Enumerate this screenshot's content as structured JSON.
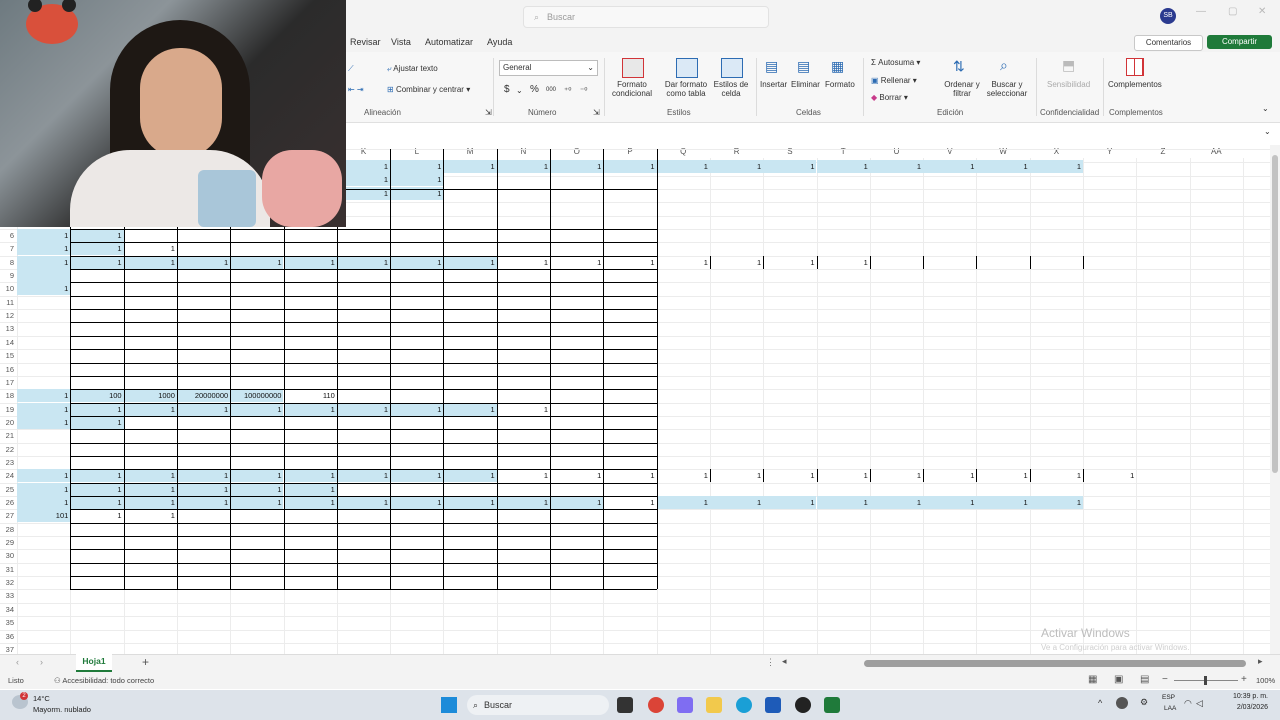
{
  "titlebar": {
    "search_placeholder": "Buscar",
    "avatar_initials": "SB"
  },
  "menu": [
    "Revisar",
    "Vista",
    "Automatizar",
    "Ayuda"
  ],
  "actions": {
    "comments": "Comentarios",
    "share": "Compartir"
  },
  "ribbon": {
    "alignment": {
      "wrap_text": "Ajustar texto",
      "merge_center": "Combinar y centrar",
      "group_label": "Alineación"
    },
    "number": {
      "format_value": "General",
      "currency": "$",
      "percent": "%",
      "thousands": "000",
      "group_label": "Número"
    },
    "styles": {
      "conditional": "Formato condicional",
      "as_table": "Dar formato como tabla",
      "cell_styles": "Estilos de celda",
      "group_label": "Estilos"
    },
    "cells": {
      "insert": "Insertar",
      "delete": "Eliminar",
      "format": "Formato",
      "group_label": "Celdas"
    },
    "editing": {
      "autosum": "Autosuma",
      "fill": "Rellenar",
      "clear": "Borrar",
      "sort_filter": "Ordenar y filtrar",
      "find_select": "Buscar y seleccionar",
      "group_label": "Edición"
    },
    "sensitivity": {
      "label": "Sensibilidad",
      "group_label": "Confidencialidad"
    },
    "addins": {
      "label": "Complementos",
      "group_label": "Complementos"
    }
  },
  "grid": {
    "columns": [
      "K",
      "L",
      "M",
      "N",
      "O",
      "P",
      "Q",
      "R",
      "S",
      "T",
      "U",
      "V",
      "W",
      "X",
      "Y",
      "Z",
      "AA"
    ],
    "rows": [
      "6",
      "7",
      "8",
      "9",
      "10",
      "11",
      "12",
      "13",
      "14",
      "15",
      "16",
      "17",
      "18",
      "19",
      "20",
      "21",
      "22",
      "23",
      "24",
      "25",
      "26",
      "27",
      "28",
      "29",
      "30",
      "31",
      "32",
      "33",
      "34",
      "35",
      "36",
      "37"
    ],
    "cells": [
      {
        "r": 0,
        "c": 0,
        "v": "1",
        "h": true
      },
      {
        "r": 0,
        "c": 1,
        "v": "1",
        "h": true
      },
      {
        "r": 1,
        "c": 0,
        "v": "1",
        "h": true
      },
      {
        "r": 1,
        "c": 1,
        "v": "1",
        "h": true
      },
      {
        "r": 1,
        "c": 2,
        "v": "1",
        "h": false
      },
      {
        "r": 2,
        "c": 0,
        "v": "1",
        "h": true
      },
      {
        "r": 2,
        "c": 1,
        "v": "1",
        "h": true
      },
      {
        "r": 2,
        "c": 2,
        "v": "1",
        "h": true
      },
      {
        "r": 2,
        "c": 3,
        "v": "1",
        "h": true
      },
      {
        "r": 2,
        "c": 4,
        "v": "1",
        "h": true
      },
      {
        "r": 2,
        "c": 5,
        "v": "1",
        "h": true
      },
      {
        "r": 2,
        "c": 6,
        "v": "1",
        "h": true
      },
      {
        "r": 2,
        "c": 7,
        "v": "1",
        "h": true
      },
      {
        "r": 2,
        "c": 8,
        "v": "1",
        "h": true
      },
      {
        "r": 2,
        "c": 9,
        "v": "1",
        "h": false
      },
      {
        "r": 2,
        "c": 10,
        "v": "1",
        "h": false
      },
      {
        "r": 2,
        "c": 11,
        "v": "1",
        "h": false
      },
      {
        "r": 2,
        "c": 12,
        "v": "1",
        "h": false
      },
      {
        "r": 2,
        "c": 13,
        "v": "1",
        "h": false
      },
      {
        "r": 2,
        "c": 14,
        "v": "1",
        "h": false
      },
      {
        "r": 2,
        "c": 15,
        "v": "1",
        "h": false
      },
      {
        "r": 3,
        "c": 0,
        "v": "",
        "h": true
      },
      {
        "r": 4,
        "c": 0,
        "v": "1",
        "h": true
      },
      {
        "r": 12,
        "c": 0,
        "v": "1",
        "h": true
      },
      {
        "r": 12,
        "c": 1,
        "v": "100",
        "h": true
      },
      {
        "r": 12,
        "c": 2,
        "v": "1000",
        "h": true
      },
      {
        "r": 12,
        "c": 3,
        "v": "20000000",
        "h": true
      },
      {
        "r": 12,
        "c": 4,
        "v": "100000000",
        "h": true
      },
      {
        "r": 12,
        "c": 5,
        "v": "110",
        "h": false
      },
      {
        "r": 13,
        "c": 0,
        "v": "1",
        "h": true
      },
      {
        "r": 13,
        "c": 1,
        "v": "1",
        "h": true
      },
      {
        "r": 13,
        "c": 2,
        "v": "1",
        "h": true
      },
      {
        "r": 13,
        "c": 3,
        "v": "1",
        "h": true
      },
      {
        "r": 13,
        "c": 4,
        "v": "1",
        "h": true
      },
      {
        "r": 13,
        "c": 5,
        "v": "1",
        "h": true
      },
      {
        "r": 13,
        "c": 6,
        "v": "1",
        "h": true
      },
      {
        "r": 13,
        "c": 7,
        "v": "1",
        "h": true
      },
      {
        "r": 13,
        "c": 8,
        "v": "1",
        "h": true
      },
      {
        "r": 13,
        "c": 9,
        "v": "1",
        "h": false
      },
      {
        "r": 14,
        "c": 0,
        "v": "1",
        "h": true
      },
      {
        "r": 14,
        "c": 1,
        "v": "1",
        "h": true
      },
      {
        "r": 18,
        "c": 0,
        "v": "1",
        "h": true
      },
      {
        "r": 18,
        "c": 1,
        "v": "1",
        "h": true
      },
      {
        "r": 18,
        "c": 2,
        "v": "1",
        "h": true
      },
      {
        "r": 18,
        "c": 3,
        "v": "1",
        "h": true
      },
      {
        "r": 18,
        "c": 4,
        "v": "1",
        "h": true
      },
      {
        "r": 18,
        "c": 5,
        "v": "1",
        "h": true
      },
      {
        "r": 18,
        "c": 6,
        "v": "1",
        "h": true
      },
      {
        "r": 18,
        "c": 7,
        "v": "1",
        "h": true
      },
      {
        "r": 18,
        "c": 8,
        "v": "1",
        "h": true
      },
      {
        "r": 18,
        "c": 9,
        "v": "1",
        "h": false
      },
      {
        "r": 18,
        "c": 10,
        "v": "1",
        "h": false
      },
      {
        "r": 18,
        "c": 11,
        "v": "1",
        "h": false
      },
      {
        "r": 18,
        "c": 12,
        "v": "1",
        "h": false
      },
      {
        "r": 18,
        "c": 13,
        "v": "1",
        "h": false
      },
      {
        "r": 18,
        "c": 14,
        "v": "1",
        "h": false
      },
      {
        "r": 18,
        "c": 15,
        "v": "1",
        "h": false
      },
      {
        "r": 18,
        "c": 16,
        "v": "1",
        "h": false
      },
      {
        "r": 18,
        "c": 17,
        "v": "1",
        "h": false
      },
      {
        "r": 18,
        "c": 18,
        "v": "1",
        "h": false
      },
      {
        "r": 18,
        "c": 19,
        "v": "1",
        "h": false
      },
      {
        "r": 18,
        "c": 20,
        "v": "1",
        "h": false
      },
      {
        "r": 19,
        "c": 0,
        "v": "1",
        "h": true
      },
      {
        "r": 19,
        "c": 1,
        "v": "1",
        "h": true
      },
      {
        "r": 19,
        "c": 2,
        "v": "1",
        "h": true
      },
      {
        "r": 19,
        "c": 3,
        "v": "1",
        "h": true
      },
      {
        "r": 19,
        "c": 4,
        "v": "1",
        "h": true
      },
      {
        "r": 19,
        "c": 5,
        "v": "1",
        "h": true
      },
      {
        "r": 20,
        "c": 0,
        "v": "1",
        "h": true
      },
      {
        "r": 20,
        "c": 1,
        "v": "1",
        "h": true
      },
      {
        "r": 20,
        "c": 2,
        "v": "1",
        "h": true
      },
      {
        "r": 20,
        "c": 3,
        "v": "1",
        "h": true
      },
      {
        "r": 20,
        "c": 4,
        "v": "1",
        "h": true
      },
      {
        "r": 20,
        "c": 5,
        "v": "1",
        "h": true
      },
      {
        "r": 20,
        "c": 6,
        "v": "1",
        "h": true
      },
      {
        "r": 20,
        "c": 7,
        "v": "1",
        "h": true
      },
      {
        "r": 20,
        "c": 8,
        "v": "1",
        "h": true
      },
      {
        "r": 20,
        "c": 9,
        "v": "1",
        "h": true
      },
      {
        "r": 20,
        "c": 10,
        "v": "1",
        "h": true
      },
      {
        "r": 20,
        "c": 11,
        "v": "1",
        "h": false
      },
      {
        "r": 20,
        "c": 12,
        "v": "1",
        "h": true
      },
      {
        "r": 20,
        "c": 13,
        "v": "1",
        "h": true
      },
      {
        "r": 20,
        "c": 14,
        "v": "1",
        "h": true
      },
      {
        "r": 20,
        "c": 15,
        "v": "1",
        "h": true
      },
      {
        "r": 20,
        "c": 16,
        "v": "1",
        "h": true
      },
      {
        "r": 20,
        "c": 17,
        "v": "1",
        "h": true
      },
      {
        "r": 20,
        "c": 18,
        "v": "1",
        "h": true
      },
      {
        "r": 20,
        "c": 19,
        "v": "1",
        "h": true
      },
      {
        "r": 21,
        "c": 0,
        "v": "101",
        "h": true
      },
      {
        "r": 21,
        "c": 1,
        "v": "1",
        "h": false
      },
      {
        "r": 21,
        "c": 2,
        "v": "1",
        "h": false
      }
    ],
    "top_cells": [
      {
        "r": 0,
        "c": 6,
        "v": "1",
        "h": true
      },
      {
        "r": 0,
        "c": 7,
        "v": "1",
        "h": true
      },
      {
        "r": 0,
        "c": 8,
        "v": "1",
        "h": true
      },
      {
        "r": 0,
        "c": 9,
        "v": "1",
        "h": true
      },
      {
        "r": 0,
        "c": 10,
        "v": "1",
        "h": true
      },
      {
        "r": 0,
        "c": 11,
        "v": "1",
        "h": true
      },
      {
        "r": 0,
        "c": 12,
        "v": "1",
        "h": true
      },
      {
        "r": 0,
        "c": 13,
        "v": "1",
        "h": true
      },
      {
        "r": 0,
        "c": 14,
        "v": "1",
        "h": true
      },
      {
        "r": 0,
        "c": 15,
        "v": "1",
        "h": true
      },
      {
        "r": 0,
        "c": 16,
        "v": "1",
        "h": true
      },
      {
        "r": 0,
        "c": 17,
        "v": "1",
        "h": true
      },
      {
        "r": 0,
        "c": 18,
        "v": "1",
        "h": true
      },
      {
        "r": 0,
        "c": 19,
        "v": "1",
        "h": true
      },
      {
        "r": 1,
        "c": 6,
        "v": "1",
        "h": true
      },
      {
        "r": 1,
        "c": 7,
        "v": "1",
        "h": true
      },
      {
        "r": 2,
        "c": 6,
        "v": "1",
        "h": true
      },
      {
        "r": 2,
        "c": 7,
        "v": "1",
        "h": true
      }
    ]
  },
  "sheet": {
    "tab": "Hoja1"
  },
  "status": {
    "ready": "Listo",
    "accessibility": "Accesibilidad: todo correcto",
    "zoom": "100%"
  },
  "watermark": {
    "title": "Activar Windows",
    "subtitle": "Ve a Configuración para activar Windows."
  },
  "taskbar": {
    "weather_temp": "14°C",
    "weather_desc": "Mayorm. nublado",
    "search": "Buscar",
    "lang1": "ESP",
    "lang2": "LAA",
    "time": "10:39 p. m.",
    "date": "2/03/2026"
  },
  "colors": {
    "highlight": "#c9e6f2",
    "share_green": "#1f7a3a",
    "grid_line": "#ececec"
  }
}
